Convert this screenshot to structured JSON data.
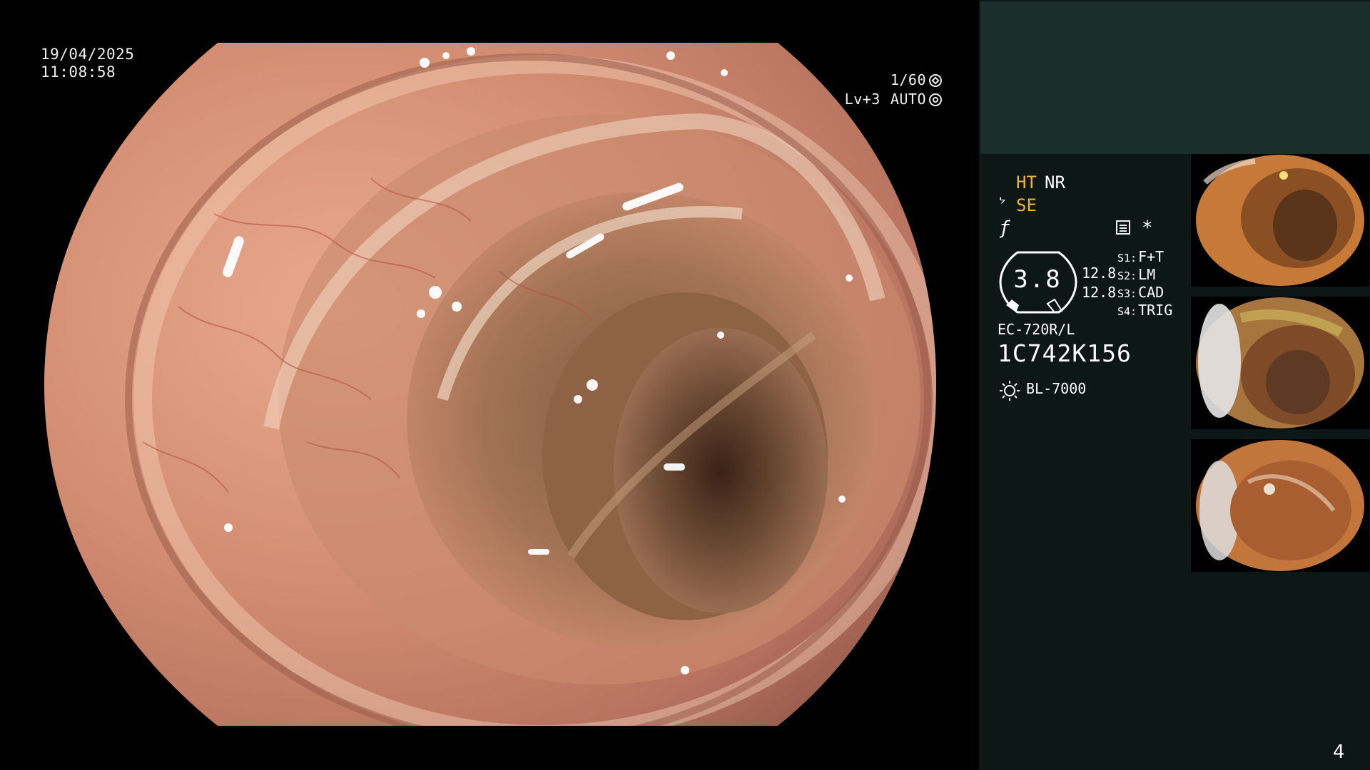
{
  "overlay": {
    "date": "19/04/2025",
    "time": "11:08:58",
    "shutter": "1/60",
    "level": "Lv+3",
    "iris_mode": "AUTO"
  },
  "panel": {
    "mode_ht": "HT",
    "mode_nr": "NR",
    "mode_se": "SE",
    "gauge_value": "3.8",
    "value_a": "12.8",
    "value_b": "12.8",
    "switches": [
      {
        "key": "S1:",
        "value": "F+T"
      },
      {
        "key": "S2:",
        "value": "LM"
      },
      {
        "key": "S3:",
        "value": "CAD"
      },
      {
        "key": "S4:",
        "value": "TRIG"
      }
    ],
    "scope_model": "EC-720R/L",
    "scope_serial": "1C742K156",
    "light_source": "BL-7000",
    "page_number": "4"
  },
  "icons": [
    "shutter-icon",
    "iris-icon",
    "se-icon",
    "f-icon",
    "menu-icon",
    "star-icon",
    "light-icon"
  ],
  "thumbnails": [
    {
      "name": "thumbnail-1"
    },
    {
      "name": "thumbnail-2"
    },
    {
      "name": "thumbnail-3"
    }
  ]
}
